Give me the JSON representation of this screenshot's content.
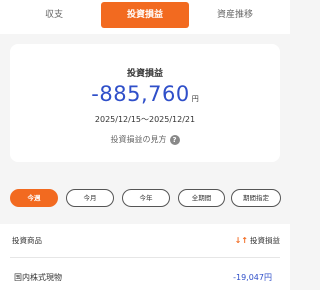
{
  "tabs": [
    {
      "label": "収支"
    },
    {
      "label": "投資損益"
    },
    {
      "label": "資産推移"
    }
  ],
  "active_tab_index": 1,
  "summary": {
    "title": "投資損益",
    "amount": "-885,760",
    "unit": "円",
    "period": "2025/12/15〜2025/12/21",
    "help_label": "投資損益の見方",
    "help_icon": "?"
  },
  "period_buttons": [
    {
      "label": "今週"
    },
    {
      "label": "今月"
    },
    {
      "label": "今年"
    },
    {
      "label": "全期間"
    },
    {
      "label": "期間指定"
    }
  ],
  "active_period_index": 0,
  "list": {
    "header_left": "投資商品",
    "sort_icon": "↓↑",
    "header_right": "投資損益",
    "rows": [
      {
        "name": "国内株式現物",
        "value": "-19,047円"
      }
    ]
  },
  "colors": {
    "accent": "#f26a20",
    "negative_value": "#2f4fc9",
    "background": "#f5f5f5"
  }
}
